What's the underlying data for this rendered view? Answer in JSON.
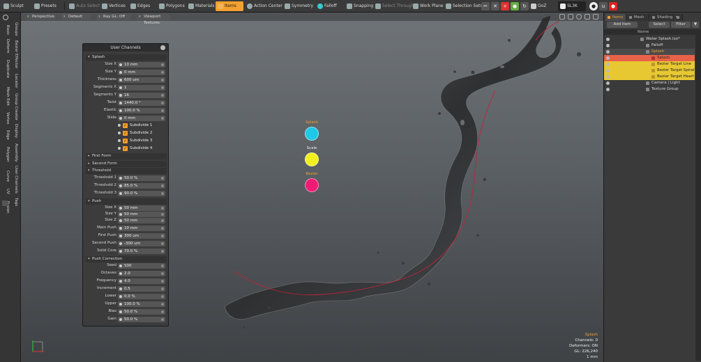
{
  "toolbar": {
    "sculpt": "Sculpt",
    "presets": "Presets",
    "auto_select": "Auto Select",
    "vertices": "Vertices",
    "edges": "Edges",
    "polygons": "Polygons",
    "materials": "Materials",
    "items": "Items",
    "action_center": "Action Center",
    "symmetry": "Symmetry",
    "falloff": "Falloff",
    "snapping": "Snapping",
    "select_through": "Select Through",
    "work_plane": "Work Plane",
    "selection_sets": "Selection Sets",
    "goz": "GoZ",
    "sl3k": "SL3K",
    "accent_color": "#f2a030"
  },
  "left_tabs": [
    "Basic",
    "Deform",
    "Duplicate",
    "Mesh Edit",
    "Vertex",
    "Edge",
    "Polygon",
    "Curve",
    "UV",
    "Fusion",
    "Groups",
    "Bezier Effector",
    "Locator",
    "Group Creator",
    "Display",
    "Assembly",
    "User Channels",
    "Tags"
  ],
  "viewport": {
    "perspective": "Perspective",
    "default": "Default",
    "ray_gl": "Ray GL: Off",
    "viewport_textures": "Viewport Textures",
    "legend": [
      {
        "label": "Splash",
        "color": "#1ec8e6"
      },
      {
        "label": "Scale",
        "color": "#f0f020"
      },
      {
        "label": "Bezier",
        "color": "#ee1c74"
      }
    ],
    "info": {
      "selection": "Splash",
      "channels": "Channels: 0",
      "deformers": "Deformers: ON",
      "gl": "GL: 226,240",
      "unit": "1 mm"
    }
  },
  "user_channels": {
    "title": "User Channels",
    "sections": {
      "splash": "Splash",
      "first_form": "First Form",
      "second_form": "Second Form",
      "threshold": "Threshold",
      "push": "Push",
      "push_correction": "Push Correction"
    },
    "splash_fields": [
      {
        "label": "Size X",
        "value": "10 mm"
      },
      {
        "label": "Size Y",
        "value": "0 mm"
      },
      {
        "label": "Thickness",
        "value": "600 um"
      },
      {
        "label": "Segments X",
        "value": "1"
      },
      {
        "label": "Segments Y",
        "value": "16"
      },
      {
        "label": "Twist",
        "value": "1440.0 °"
      },
      {
        "label": "Elastic",
        "value": "100.0 %"
      },
      {
        "label": "Slide",
        "value": "0 mm"
      }
    ],
    "subdivide": [
      "Subdivide 1",
      "Subdivide 2",
      "Subdivide 3",
      "Subdivide 4"
    ],
    "threshold_fields": [
      {
        "label": "Threshold 1",
        "value": "50.0 %"
      },
      {
        "label": "Threshold 2",
        "value": "85.0 %"
      },
      {
        "label": "Threshold 3",
        "value": "90.0 %"
      }
    ],
    "push_fields": [
      {
        "label": "Size X",
        "value": "50 mm"
      },
      {
        "label": "Size Y",
        "value": "50 mm"
      },
      {
        "label": "Size Z",
        "value": "50 mm"
      },
      {
        "label": "Main Push",
        "value": "10 mm"
      },
      {
        "label": "First Push",
        "value": "300 um"
      },
      {
        "label": "Second Push",
        "value": "-300 um"
      },
      {
        "label": "Solid Core",
        "value": "70.0 %"
      }
    ],
    "correction_fields": [
      {
        "label": "Seed",
        "value": "500"
      },
      {
        "label": "Octaves",
        "value": "2.0"
      },
      {
        "label": "Frequency",
        "value": "4.0"
      },
      {
        "label": "Increment",
        "value": "0.5"
      },
      {
        "label": "Lower",
        "value": "0.0 %"
      },
      {
        "label": "Upper",
        "value": "100.0 %"
      },
      {
        "label": "Bias",
        "value": "50.0 %"
      },
      {
        "label": "Gain",
        "value": "50.0 %"
      }
    ]
  },
  "right_panel": {
    "tabs": [
      "Items",
      "Mesh ...",
      "Shading"
    ],
    "add_item": "Add Item",
    "select": "Select",
    "filter": "Filter",
    "name_header": "Name",
    "items": [
      {
        "label": "Water Splash.lxo*",
        "indent": 0,
        "style": "normal"
      },
      {
        "label": "Falloff",
        "indent": 1,
        "style": "normal"
      },
      {
        "label": "Splash",
        "indent": 1,
        "style": "grp"
      },
      {
        "label": "Splash",
        "indent": 2,
        "style": "sel"
      },
      {
        "label": "Bezier Target Line",
        "indent": 2,
        "style": "hl"
      },
      {
        "label": "Bezier Target Spiral",
        "indent": 2,
        "style": "hl"
      },
      {
        "label": "Bezier Target Heart",
        "indent": 2,
        "style": "hl"
      },
      {
        "label": "Camera | Light",
        "indent": 1,
        "style": "normal"
      },
      {
        "label": "Texture Group",
        "indent": 1,
        "style": "normal"
      }
    ]
  }
}
